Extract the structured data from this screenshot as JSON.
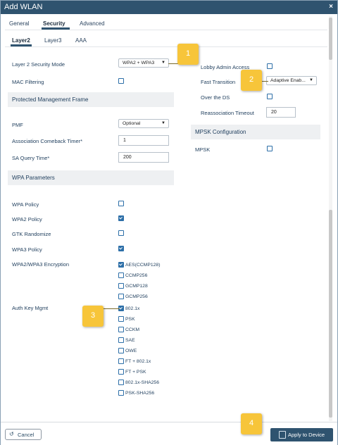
{
  "dialog": {
    "title": "Add WLAN",
    "close_icon": "×",
    "tabs": [
      "General",
      "Security",
      "Advanced"
    ],
    "subtabs": [
      "Layer2",
      "Layer3",
      "AAA"
    ]
  },
  "left": {
    "l2_mode_label": "Layer 2 Security Mode",
    "l2_mode_value": "WPA2 + WPA3",
    "mac_filtering_label": "MAC Filtering",
    "pmf_section": "Protected Management Frame",
    "pmf_label": "PMF",
    "pmf_value": "Optional",
    "assoc_label": "Association Comeback Timer*",
    "assoc_value": "1",
    "saquery_label": "SA Query Time*",
    "saquery_value": "200",
    "wpa_section": "WPA Parameters",
    "wpa_policy_label": "WPA Policy",
    "wpa2_policy_label": "WPA2 Policy",
    "gtk_label": "GTK Randomize",
    "wpa3_policy_label": "WPA3 Policy",
    "encryption_label": "WPA2/WPA3 Encryption",
    "encryption_options": [
      "AES(CCMP128)",
      "CCMP256",
      "GCMP128",
      "GCMP256"
    ],
    "akm_label": "Auth Key Mgmt",
    "akm_options": [
      "802.1x",
      "PSK",
      "CCKM",
      "SAE",
      "OWE",
      "FT + 802.1x",
      "FT + PSK",
      "802.1x-SHA256",
      "PSK-SHA256"
    ]
  },
  "right": {
    "lobby_label": "Lobby Admin Access",
    "ft_label": "Fast Transition",
    "ft_value": "Adaptive Enab...",
    "over_ds_label": "Over the DS",
    "reassoc_label": "Reassociation Timeout",
    "reassoc_value": "20",
    "mpsk_section": "MPSK Configuration",
    "mpsk_label": "MPSK"
  },
  "callouts": [
    "1",
    "2",
    "3",
    "4"
  ],
  "footer": {
    "cancel_label": "Cancel",
    "cancel_icon": "↺",
    "apply_label": "Apply to Device"
  }
}
